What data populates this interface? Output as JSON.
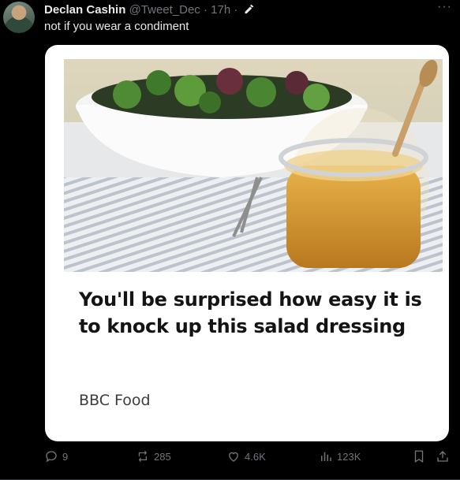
{
  "tweet": {
    "display_name": "Declan Cashin",
    "handle": "@Tweet_Dec",
    "separator": "·",
    "time": "17h",
    "text": "not if you wear a condiment",
    "more_label": "···"
  },
  "card": {
    "headline": "You'll be surprised how easy it is to knock up this salad dressing",
    "source": "BBC Food"
  },
  "actions": {
    "replies": "9",
    "reposts": "285",
    "likes": "4.6K",
    "views": "123K"
  },
  "colors": {
    "background": "#000000",
    "text_primary": "#e7e9ea",
    "text_secondary": "#71767b",
    "card_bg": "#ffffff",
    "headline": "#141414"
  }
}
